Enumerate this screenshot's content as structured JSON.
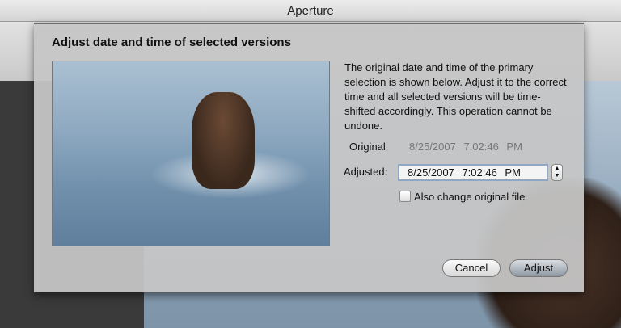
{
  "window": {
    "title": "Aperture"
  },
  "dialog": {
    "title": "Adjust date and time of selected versions",
    "description": "The original date and time of the primary selection is shown below. Adjust it to the correct time and all selected versions will be time-shifted accordingly. This operation cannot be undone.",
    "original_label": "Original:",
    "original_value": "8/25/2007  7:02:46  PM",
    "adjusted_label": "Adjusted:",
    "adjusted_value": "8/25/2007  7:02:46  PM",
    "checkbox_label": "Also change original file",
    "checkbox_checked": false,
    "cancel_label": "Cancel",
    "adjust_label": "Adjust"
  }
}
